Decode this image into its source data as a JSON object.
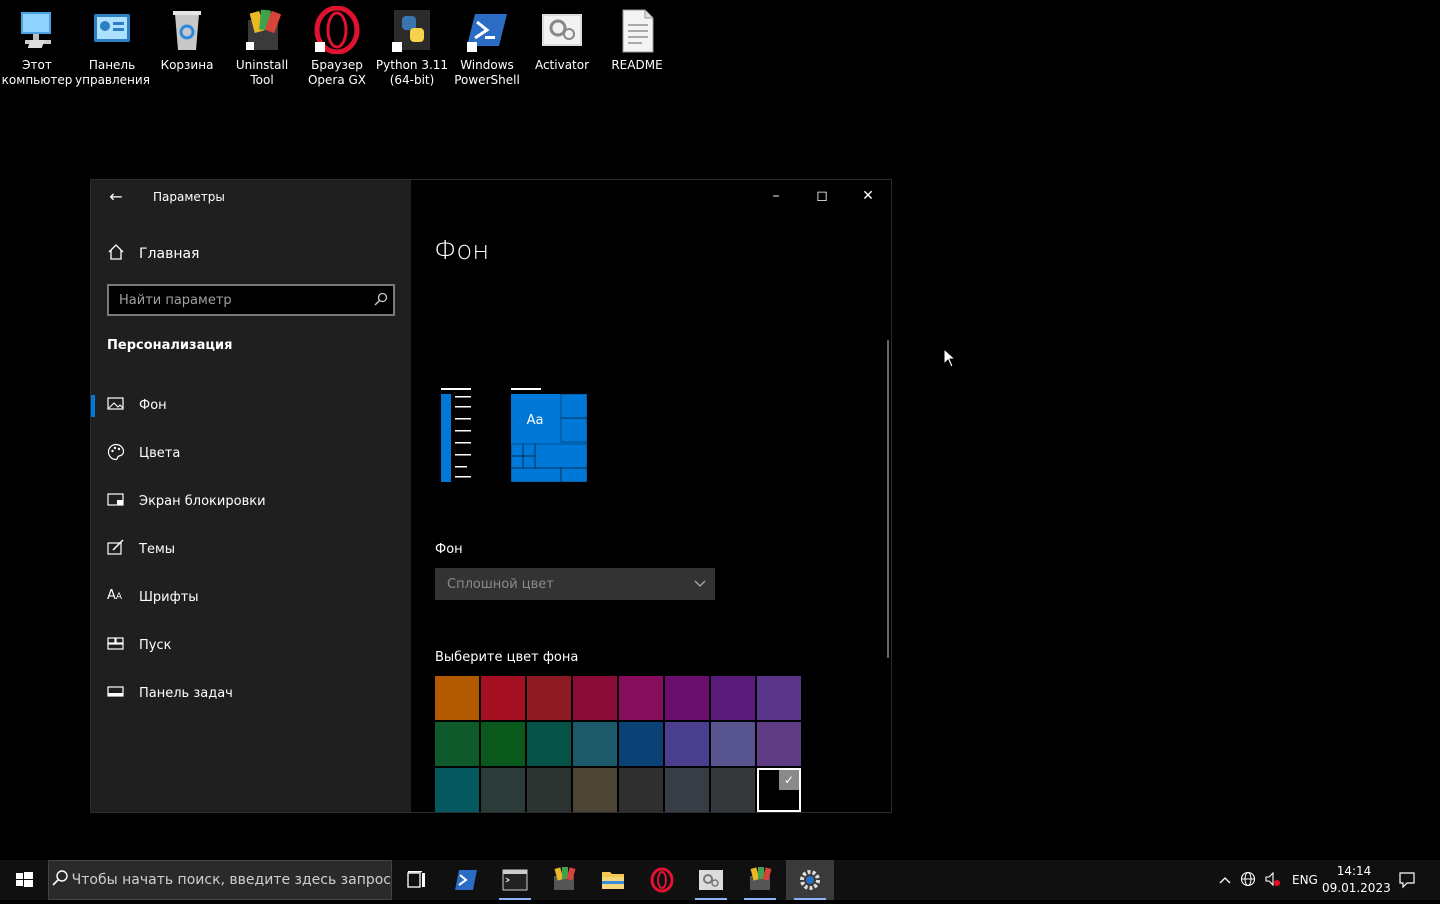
{
  "desktop": {
    "icons": [
      {
        "label": "Этот компьютер",
        "icon": "computer-icon"
      },
      {
        "label": "Панель управления",
        "icon": "control-panel-icon"
      },
      {
        "label": "Корзина",
        "icon": "recycle-bin-icon"
      },
      {
        "label": "Uninstall Tool",
        "icon": "uninstall-tool-icon"
      },
      {
        "label": "Браузер Opera GX",
        "icon": "opera-gx-icon"
      },
      {
        "label": "Python 3.11 (64-bit)",
        "icon": "python-icon"
      },
      {
        "label": "Windows PowerShell",
        "icon": "powershell-icon"
      },
      {
        "label": "Activator",
        "icon": "activator-icon"
      },
      {
        "label": "README",
        "icon": "document-icon"
      }
    ]
  },
  "window": {
    "app_title": "Параметры",
    "home": "Главная",
    "search_placeholder": "Найти параметр",
    "section": "Персонализация",
    "nav": [
      {
        "label": "Фон",
        "icon": "picture-icon",
        "selected": true
      },
      {
        "label": "Цвета",
        "icon": "palette-icon",
        "selected": false
      },
      {
        "label": "Экран блокировки",
        "icon": "lock-screen-icon",
        "selected": false
      },
      {
        "label": "Темы",
        "icon": "themes-icon",
        "selected": false
      },
      {
        "label": "Шрифты",
        "icon": "fonts-icon",
        "selected": false
      },
      {
        "label": "Пуск",
        "icon": "start-icon",
        "selected": false
      },
      {
        "label": "Панель задач",
        "icon": "taskbar-icon",
        "selected": false
      }
    ],
    "page_title": "Фон",
    "preview_tile_text": "Aa",
    "background_label": "Фон",
    "background_value": "Сплошной цвет",
    "pick_label": "Выберите цвет фона",
    "accent": "#0078d7",
    "swatch_colors": [
      [
        "#b35a00",
        "#a50f22",
        "#8e1b23",
        "#8a0c36",
        "#850d5c",
        "#6a0f6e",
        "#5a1a7a",
        "#5b3587"
      ],
      [
        "#0e5a2a",
        "#0b5a1d",
        "#075246",
        "#1c5a6a",
        "#0a4276",
        "#4a3f8f",
        "#58548f",
        "#5e3d84"
      ],
      [
        "#055860",
        "#2a3b3a",
        "#2d3330",
        "#4c4434",
        "#2f2f2f",
        "#383c44",
        "#35383a",
        "#000000"
      ]
    ],
    "selected_swatch": "row3-col8"
  },
  "taskbar": {
    "search_placeholder": "Чтобы начать поиск, введите здесь запрос",
    "apps": [
      {
        "name": "task-view-icon"
      },
      {
        "name": "powershell-icon"
      },
      {
        "name": "terminal-icon"
      },
      {
        "name": "archiver-icon"
      },
      {
        "name": "file-explorer-icon"
      },
      {
        "name": "opera-gx-icon"
      },
      {
        "name": "activator-icon"
      },
      {
        "name": "archiver2-icon"
      },
      {
        "name": "settings-icon"
      }
    ],
    "lang": "ENG",
    "time": "14:14",
    "date": "09.01.2023"
  }
}
